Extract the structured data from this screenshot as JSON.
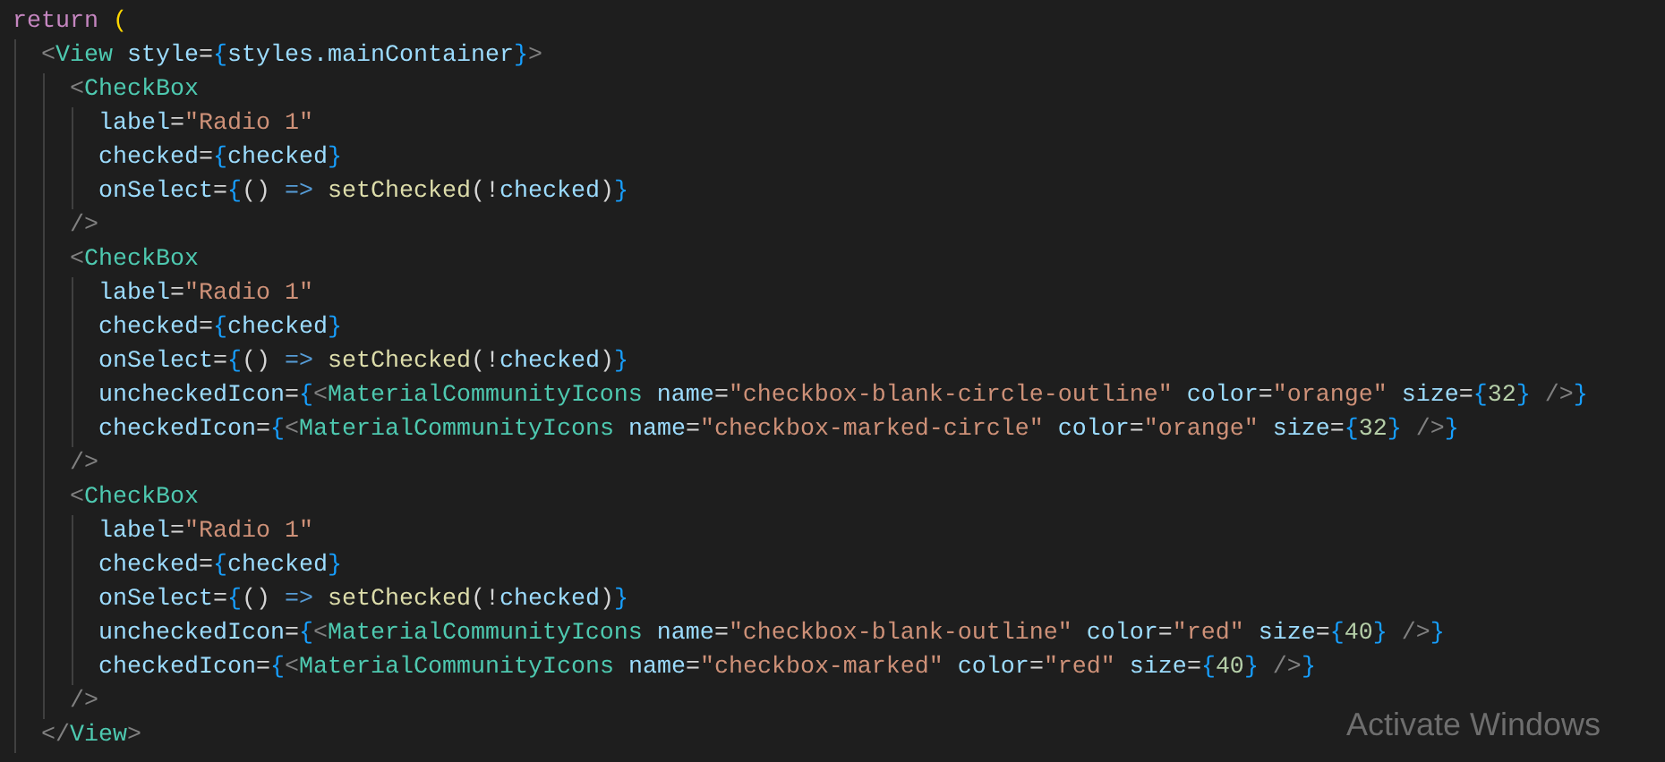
{
  "editor": {
    "lines": [
      {
        "tokens": [
          {
            "kind": "keyword",
            "text": "return"
          },
          {
            "kind": "paren",
            "text": " ("
          }
        ]
      },
      {
        "tokens": [
          {
            "kind": "punct",
            "text": "  <"
          },
          {
            "kind": "tag",
            "text": "View"
          },
          {
            "kind": "attr",
            "text": " style"
          },
          {
            "kind": "op",
            "text": "="
          },
          {
            "kind": "brace",
            "text": "{"
          },
          {
            "kind": "var",
            "text": "styles.mainContainer"
          },
          {
            "kind": "brace",
            "text": "}"
          },
          {
            "kind": "punct",
            "text": ">"
          }
        ]
      },
      {
        "tokens": [
          {
            "kind": "punct",
            "text": "    <"
          },
          {
            "kind": "tag",
            "text": "CheckBox"
          }
        ]
      },
      {
        "tokens": [
          {
            "kind": "attr",
            "text": "      label"
          },
          {
            "kind": "op",
            "text": "="
          },
          {
            "kind": "string",
            "text": "\"Radio 1\""
          }
        ]
      },
      {
        "tokens": [
          {
            "kind": "attr",
            "text": "      checked"
          },
          {
            "kind": "op",
            "text": "="
          },
          {
            "kind": "brace",
            "text": "{"
          },
          {
            "kind": "var",
            "text": "checked"
          },
          {
            "kind": "brace",
            "text": "}"
          }
        ]
      },
      {
        "tokens": [
          {
            "kind": "attr",
            "text": "      onSelect"
          },
          {
            "kind": "op",
            "text": "="
          },
          {
            "kind": "brace",
            "text": "{"
          },
          {
            "kind": "op",
            "text": "()"
          },
          {
            "kind": "arrow",
            "text": " =>"
          },
          {
            "kind": "func",
            "text": " setChecked"
          },
          {
            "kind": "op",
            "text": "(!"
          },
          {
            "kind": "var",
            "text": "checked"
          },
          {
            "kind": "op",
            "text": ")"
          },
          {
            "kind": "brace",
            "text": "}"
          }
        ]
      },
      {
        "tokens": [
          {
            "kind": "punct",
            "text": "    />"
          }
        ]
      },
      {
        "tokens": [
          {
            "kind": "punct",
            "text": "    <"
          },
          {
            "kind": "tag",
            "text": "CheckBox"
          }
        ]
      },
      {
        "tokens": [
          {
            "kind": "attr",
            "text": "      label"
          },
          {
            "kind": "op",
            "text": "="
          },
          {
            "kind": "string",
            "text": "\"Radio 1\""
          }
        ]
      },
      {
        "tokens": [
          {
            "kind": "attr",
            "text": "      checked"
          },
          {
            "kind": "op",
            "text": "="
          },
          {
            "kind": "brace",
            "text": "{"
          },
          {
            "kind": "var",
            "text": "checked"
          },
          {
            "kind": "brace",
            "text": "}"
          }
        ]
      },
      {
        "tokens": [
          {
            "kind": "attr",
            "text": "      onSelect"
          },
          {
            "kind": "op",
            "text": "="
          },
          {
            "kind": "brace",
            "text": "{"
          },
          {
            "kind": "op",
            "text": "()"
          },
          {
            "kind": "arrow",
            "text": " =>"
          },
          {
            "kind": "func",
            "text": " setChecked"
          },
          {
            "kind": "op",
            "text": "(!"
          },
          {
            "kind": "var",
            "text": "checked"
          },
          {
            "kind": "op",
            "text": ")"
          },
          {
            "kind": "brace",
            "text": "}"
          }
        ]
      },
      {
        "tokens": [
          {
            "kind": "attr",
            "text": "      uncheckedIcon"
          },
          {
            "kind": "op",
            "text": "="
          },
          {
            "kind": "brace",
            "text": "{"
          },
          {
            "kind": "punct",
            "text": "<"
          },
          {
            "kind": "tag",
            "text": "MaterialCommunityIcons"
          },
          {
            "kind": "attr",
            "text": " name"
          },
          {
            "kind": "op",
            "text": "="
          },
          {
            "kind": "string",
            "text": "\"checkbox-blank-circle-outline\""
          },
          {
            "kind": "attr",
            "text": " color"
          },
          {
            "kind": "op",
            "text": "="
          },
          {
            "kind": "string",
            "text": "\"orange\""
          },
          {
            "kind": "attr",
            "text": " size"
          },
          {
            "kind": "op",
            "text": "="
          },
          {
            "kind": "brace",
            "text": "{"
          },
          {
            "kind": "number",
            "text": "32"
          },
          {
            "kind": "brace",
            "text": "}"
          },
          {
            "kind": "punct",
            "text": " />"
          },
          {
            "kind": "brace",
            "text": "}"
          }
        ]
      },
      {
        "tokens": [
          {
            "kind": "attr",
            "text": "      checkedIcon"
          },
          {
            "kind": "op",
            "text": "="
          },
          {
            "kind": "brace",
            "text": "{"
          },
          {
            "kind": "punct",
            "text": "<"
          },
          {
            "kind": "tag",
            "text": "MaterialCommunityIcons"
          },
          {
            "kind": "attr",
            "text": " name"
          },
          {
            "kind": "op",
            "text": "="
          },
          {
            "kind": "string",
            "text": "\"checkbox-marked-circle\""
          },
          {
            "kind": "attr",
            "text": " color"
          },
          {
            "kind": "op",
            "text": "="
          },
          {
            "kind": "string",
            "text": "\"orange\""
          },
          {
            "kind": "attr",
            "text": " size"
          },
          {
            "kind": "op",
            "text": "="
          },
          {
            "kind": "brace",
            "text": "{"
          },
          {
            "kind": "number",
            "text": "32"
          },
          {
            "kind": "brace",
            "text": "}"
          },
          {
            "kind": "punct",
            "text": " />"
          },
          {
            "kind": "brace",
            "text": "}"
          }
        ]
      },
      {
        "tokens": [
          {
            "kind": "punct",
            "text": "    />"
          }
        ]
      },
      {
        "tokens": [
          {
            "kind": "punct",
            "text": "    <"
          },
          {
            "kind": "tag",
            "text": "CheckBox"
          }
        ]
      },
      {
        "tokens": [
          {
            "kind": "attr",
            "text": "      label"
          },
          {
            "kind": "op",
            "text": "="
          },
          {
            "kind": "string",
            "text": "\"Radio 1\""
          }
        ]
      },
      {
        "tokens": [
          {
            "kind": "attr",
            "text": "      checked"
          },
          {
            "kind": "op",
            "text": "="
          },
          {
            "kind": "brace",
            "text": "{"
          },
          {
            "kind": "var",
            "text": "checked"
          },
          {
            "kind": "brace",
            "text": "}"
          }
        ]
      },
      {
        "tokens": [
          {
            "kind": "attr",
            "text": "      onSelect"
          },
          {
            "kind": "op",
            "text": "="
          },
          {
            "kind": "brace",
            "text": "{"
          },
          {
            "kind": "op",
            "text": "()"
          },
          {
            "kind": "arrow",
            "text": " =>"
          },
          {
            "kind": "func",
            "text": " setChecked"
          },
          {
            "kind": "op",
            "text": "(!"
          },
          {
            "kind": "var",
            "text": "checked"
          },
          {
            "kind": "op",
            "text": ")"
          },
          {
            "kind": "brace",
            "text": "}"
          }
        ]
      },
      {
        "tokens": [
          {
            "kind": "attr",
            "text": "      uncheckedIcon"
          },
          {
            "kind": "op",
            "text": "="
          },
          {
            "kind": "brace",
            "text": "{"
          },
          {
            "kind": "punct",
            "text": "<"
          },
          {
            "kind": "tag",
            "text": "MaterialCommunityIcons"
          },
          {
            "kind": "attr",
            "text": " name"
          },
          {
            "kind": "op",
            "text": "="
          },
          {
            "kind": "string",
            "text": "\"checkbox-blank-outline\""
          },
          {
            "kind": "attr",
            "text": " color"
          },
          {
            "kind": "op",
            "text": "="
          },
          {
            "kind": "string",
            "text": "\"red\""
          },
          {
            "kind": "attr",
            "text": " size"
          },
          {
            "kind": "op",
            "text": "="
          },
          {
            "kind": "brace",
            "text": "{"
          },
          {
            "kind": "number",
            "text": "40"
          },
          {
            "kind": "brace",
            "text": "}"
          },
          {
            "kind": "punct",
            "text": " />"
          },
          {
            "kind": "brace",
            "text": "}"
          }
        ]
      },
      {
        "tokens": [
          {
            "kind": "attr",
            "text": "      checkedIcon"
          },
          {
            "kind": "op",
            "text": "="
          },
          {
            "kind": "brace",
            "text": "{"
          },
          {
            "kind": "punct",
            "text": "<"
          },
          {
            "kind": "tag",
            "text": "MaterialCommunityIcons"
          },
          {
            "kind": "attr",
            "text": " name"
          },
          {
            "kind": "op",
            "text": "="
          },
          {
            "kind": "string",
            "text": "\"checkbox-marked\""
          },
          {
            "kind": "attr",
            "text": " color"
          },
          {
            "kind": "op",
            "text": "="
          },
          {
            "kind": "string",
            "text": "\"red\""
          },
          {
            "kind": "attr",
            "text": " size"
          },
          {
            "kind": "op",
            "text": "="
          },
          {
            "kind": "brace",
            "text": "{"
          },
          {
            "kind": "number",
            "text": "40"
          },
          {
            "kind": "brace",
            "text": "}"
          },
          {
            "kind": "punct",
            "text": " />"
          },
          {
            "kind": "brace",
            "text": "}"
          }
        ]
      },
      {
        "tokens": [
          {
            "kind": "punct",
            "text": "    />"
          }
        ]
      },
      {
        "tokens": [
          {
            "kind": "punct",
            "text": "  </"
          },
          {
            "kind": "tag",
            "text": "View"
          },
          {
            "kind": "punct",
            "text": ">"
          }
        ]
      }
    ]
  },
  "activation_notice": {
    "title": "Activate Windows"
  }
}
